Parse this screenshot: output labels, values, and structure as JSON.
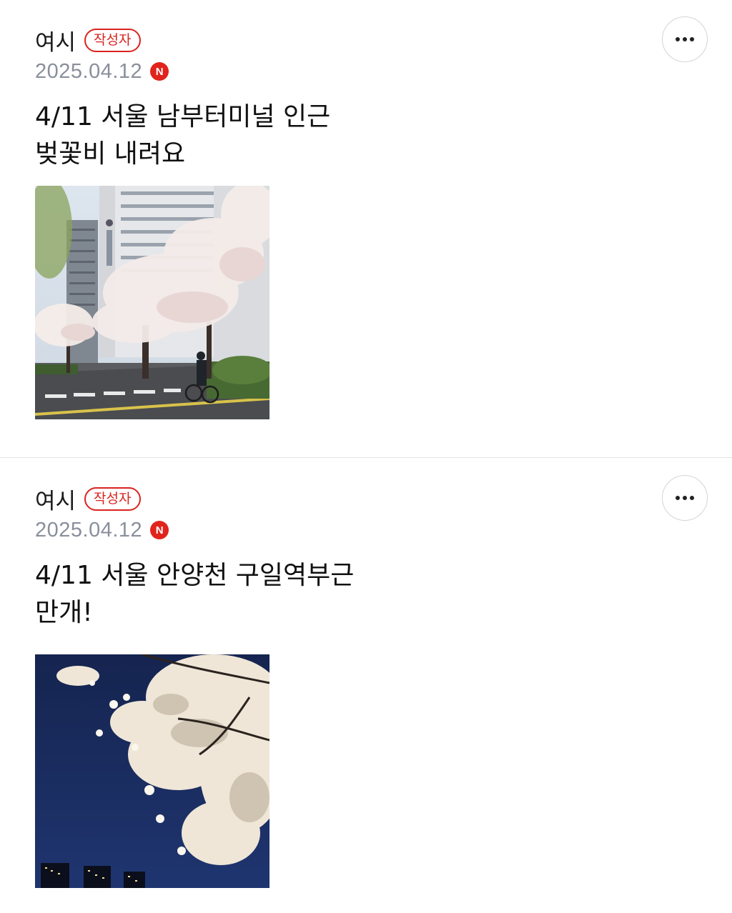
{
  "posts": [
    {
      "author": "여시",
      "writer_badge": "작성자",
      "date": "2025.04.12",
      "new_badge": "N",
      "title_lines": [
        "4/11 서울 남부터미널 인근",
        "벚꽃비 내려요"
      ],
      "more_icon": "ellipsis-icon",
      "photo": "cherry-blossom-street-photo"
    },
    {
      "author": "여시",
      "writer_badge": "작성자",
      "date": "2025.04.12",
      "new_badge": "N",
      "title_lines": [
        "4/11 서울 안양천 구일역부근",
        "만개!"
      ],
      "more_icon": "ellipsis-icon",
      "photo": "cherry-blossom-night-photo"
    }
  ],
  "colors": {
    "accent_red": "#d9231e",
    "date_gray": "#8a8f9c",
    "divider": "#e3e3e6"
  }
}
